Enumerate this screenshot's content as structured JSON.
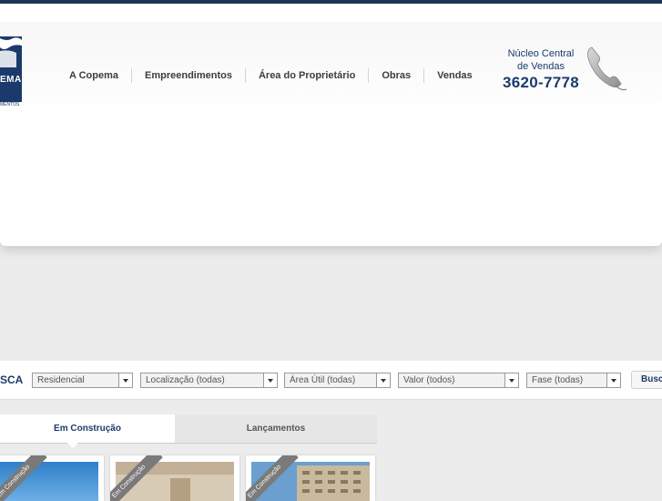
{
  "brand": {
    "logo_text": "EMA",
    "logo_sub": "MENTOS"
  },
  "nav": {
    "items": [
      "A Copema",
      "Empreendimentos",
      "Área do Proprietário",
      "Obras",
      "Vendas"
    ]
  },
  "sales": {
    "line1": "Núcleo Central",
    "line2": "de Vendas",
    "phone": "3620-7778"
  },
  "search": {
    "label": "SCA",
    "type": "Residencial",
    "location": "Localização (todas)",
    "area": "Área Útil (todas)",
    "value": "Valor (todos)",
    "phase": "Fase (todas)",
    "button": "Busca"
  },
  "tabs": {
    "active": "Em Construção",
    "inactive": "Lançamentos"
  },
  "cards": [
    {
      "badge": "Em Construção"
    },
    {
      "badge": "Em Construção"
    },
    {
      "badge": "Em Construção"
    }
  ],
  "colors": {
    "brand_blue": "#1b3a6b",
    "top_bar": "#1d3557"
  },
  "icons": [
    "phone-icon",
    "dropdown-arrow-icon"
  ]
}
